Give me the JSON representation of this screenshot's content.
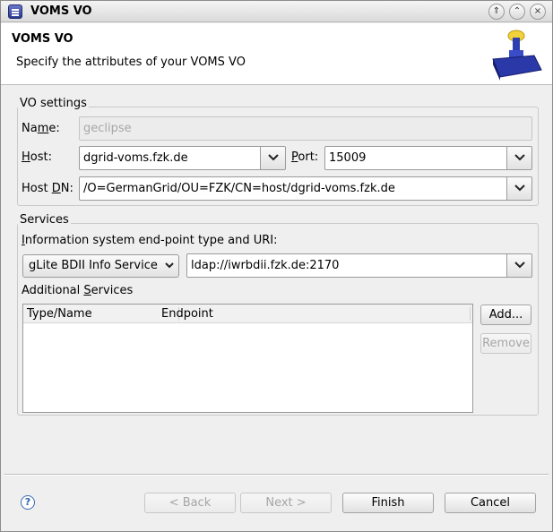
{
  "window": {
    "title": "VOMS VO"
  },
  "titlebar_buttons": {
    "shade": "⇑",
    "maximize": "⌃",
    "close": "×"
  },
  "header": {
    "title": "VOMS VO",
    "description": "Specify the attributes of your VOMS VO"
  },
  "vo_settings": {
    "legend": "VO settings",
    "name_label_pre": "Na",
    "name_label_mn": "m",
    "name_label_post": "e:",
    "name_value": "geclipse",
    "host_label_mn": "H",
    "host_label_post": "ost:",
    "host_value": "dgrid-voms.fzk.de",
    "port_label_mn": "P",
    "port_label_post": "ort:",
    "port_value": "15009",
    "hostdn_label_pre": "Host ",
    "hostdn_label_mn": "D",
    "hostdn_label_post": "N:",
    "hostdn_value": "/O=GermanGrid/OU=FZK/CN=host/dgrid-voms.fzk.de"
  },
  "services": {
    "legend": "Services",
    "info_label_mn": "I",
    "info_label_post": "nformation system end-point type and URI:",
    "info_type_selected": "gLite BDII Info Service",
    "info_uri_value": "ldap://iwrbdii.fzk.de:2170",
    "additional_label_pre": "Additional ",
    "additional_label_mn": "S",
    "additional_label_post": "ervices",
    "table_columns": [
      "Type/Name",
      "Endpoint"
    ],
    "add_label_pre": "Add...",
    "remove_label": "Remove"
  },
  "footer": {
    "help_icon": "?",
    "back_label": "< Back",
    "next_label": "Next >",
    "finish_label": "Finish",
    "cancel_label": "Cancel"
  }
}
